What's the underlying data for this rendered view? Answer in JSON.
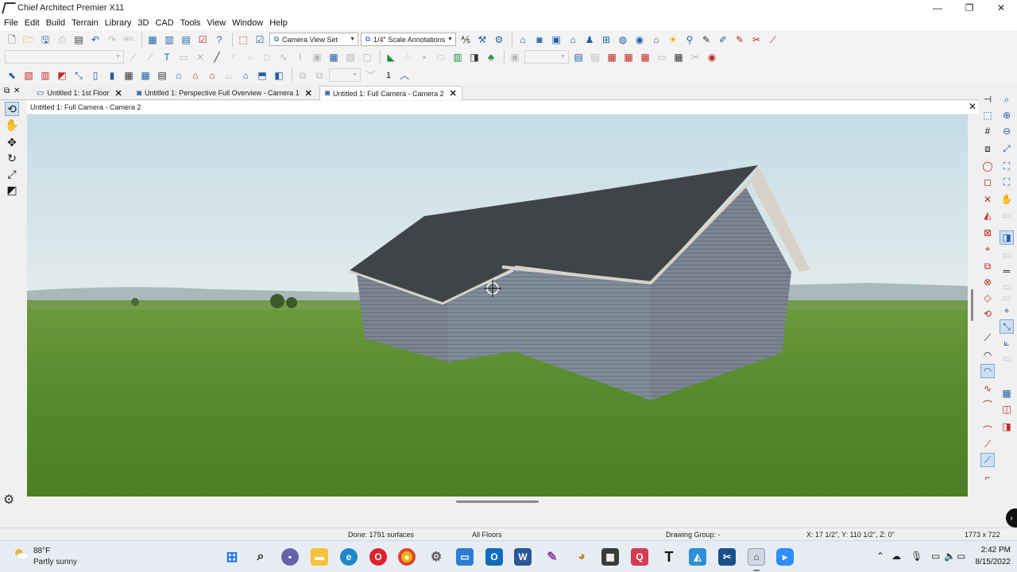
{
  "window": {
    "title": "Chief Architect Premier X11",
    "controls": [
      "minimize",
      "maximize",
      "close"
    ]
  },
  "menu": [
    "File",
    "Edit",
    "Build",
    "Terrain",
    "Library",
    "3D",
    "CAD",
    "Tools",
    "View",
    "Window",
    "Help"
  ],
  "toolbar": {
    "camera_view_set": "Camera View Set",
    "annotation_set": "1/4\" Scale Annotations",
    "dimension_value": "1"
  },
  "tabs": [
    {
      "label": "Untitled 1: 1st Floor",
      "active": false
    },
    {
      "label": "Untitled 1: Perspective Full Overview - Camera 1",
      "active": false
    },
    {
      "label": "Untitled 1: Full Camera - Camera 2",
      "active": true
    }
  ],
  "viewport": {
    "title": "Untitled 1: Full Camera - Camera 2",
    "scene": "3D camera view of house with gray siding and dark shingle roof over green field",
    "colors": {
      "sky_top": "#c9dde4",
      "sky_bottom": "#dfe9ea",
      "grass": "#5b8a2e",
      "siding": "#7f8b97",
      "roof": "#3f4448",
      "trim": "#d7d2c8"
    }
  },
  "status": {
    "done": "Done:  1791 surfaces",
    "floors": "All Floors",
    "drawing_group": "Drawing Group: -",
    "coords": "X: 17 1/2\", Y: 110 1/2\", Z: 0\"",
    "size": "1773 x 722"
  },
  "taskbar": {
    "weather_temp": "88°F",
    "weather_desc": "Partly sunny",
    "time": "2:42 PM",
    "date": "8/15/2022",
    "apps": [
      "start-icon",
      "search-icon",
      "chat-icon",
      "file-explorer-icon",
      "edge-icon",
      "opera-icon",
      "chrome-icon",
      "settings-icon",
      "remote-desktop-icon",
      "outlook-icon",
      "word-icon",
      "paint-icon",
      "calculator-icon",
      "q-app-icon",
      "typora-icon",
      "photos-icon",
      "snipping-icon",
      "chief-architect-icon",
      "zoom-icon"
    ]
  }
}
